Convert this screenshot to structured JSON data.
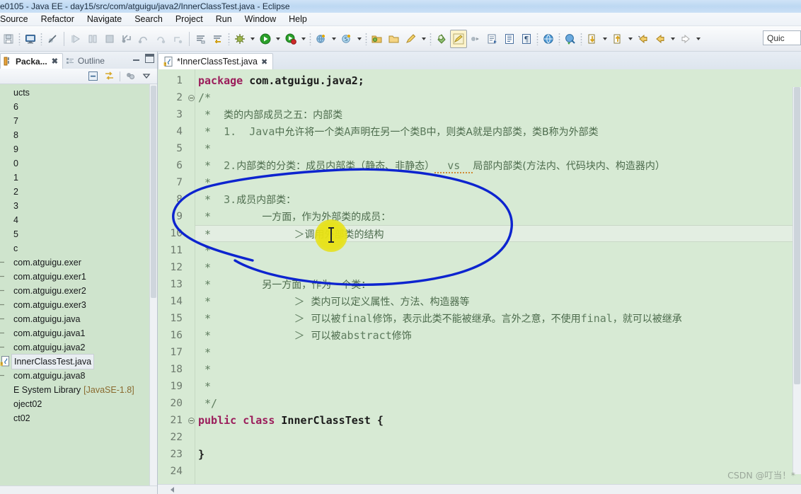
{
  "window": {
    "title": "e0105 - Java EE - day15/src/com/atguigu/java2/InnerClassTest.java - Eclipse"
  },
  "menubar": {
    "items": [
      {
        "label": "Source"
      },
      {
        "label": "Refactor"
      },
      {
        "label": "Navigate"
      },
      {
        "label": "Search"
      },
      {
        "label": "Project"
      },
      {
        "label": "Run"
      },
      {
        "label": "Window"
      },
      {
        "label": "Help"
      }
    ]
  },
  "toolbar": {
    "quick_access_text": "Quic",
    "buttons": [
      {
        "name": "save-icon"
      },
      {
        "name": "console-icon"
      },
      {
        "name": "skip-breakpoints-icon"
      },
      {
        "name": "resume-icon"
      },
      {
        "name": "suspend-icon"
      },
      {
        "name": "terminate-icon"
      },
      {
        "name": "step-into-icon"
      },
      {
        "name": "step-over-icon"
      },
      {
        "name": "step-return-icon"
      },
      {
        "name": "drop-to-frame-icon"
      },
      {
        "name": "open-task-icon"
      },
      {
        "name": "toggle-task-icon"
      },
      {
        "name": "debug-icon"
      },
      {
        "name": "run-icon"
      },
      {
        "name": "run-coverage-icon"
      },
      {
        "name": "external-tools-icon"
      },
      {
        "name": "search-icon"
      },
      {
        "name": "new-java-package-icon"
      },
      {
        "name": "new-java-class-icon"
      },
      {
        "name": "new-annotation-icon"
      },
      {
        "name": "new-java-project-icon"
      },
      {
        "name": "new-folder-icon"
      },
      {
        "name": "toggle-mark-occurrences-icon"
      },
      {
        "name": "next-annotation-icon"
      },
      {
        "name": "open-type-icon"
      },
      {
        "name": "open-task-list-icon"
      },
      {
        "name": "pilcrow-icon"
      },
      {
        "name": "open-web-browser-icon"
      },
      {
        "name": "previous-edit-icon"
      },
      {
        "name": "next-edit-icon"
      },
      {
        "name": "back-icon"
      },
      {
        "name": "forward-icon"
      }
    ]
  },
  "left_panel": {
    "tabs": [
      {
        "label": "Packa...",
        "active": true,
        "closable": true
      },
      {
        "label": "Outline",
        "active": false,
        "closable": false
      }
    ],
    "view_toolbar": [
      {
        "name": "collapse-all-icon"
      },
      {
        "name": "link-with-editor-icon"
      },
      {
        "name": "view-menu-filters-icon"
      },
      {
        "name": "view-menu-icon"
      }
    ],
    "tree": [
      {
        "label": "ucts",
        "type": "truncated"
      },
      {
        "label": "6",
        "type": "truncated"
      },
      {
        "label": "7",
        "type": "truncated"
      },
      {
        "label": "8",
        "type": "truncated"
      },
      {
        "label": "9",
        "type": "truncated"
      },
      {
        "label": "0",
        "type": "truncated"
      },
      {
        "label": "1",
        "type": "truncated"
      },
      {
        "label": "2",
        "type": "truncated"
      },
      {
        "label": "3",
        "type": "truncated"
      },
      {
        "label": "4",
        "type": "truncated"
      },
      {
        "label": "5",
        "type": "truncated"
      },
      {
        "label": "c",
        "type": "truncated"
      },
      {
        "label": "com.atguigu.exer",
        "type": "package"
      },
      {
        "label": "com.atguigu.exer1",
        "type": "package"
      },
      {
        "label": "com.atguigu.exer2",
        "type": "package"
      },
      {
        "label": "com.atguigu.exer3",
        "type": "package"
      },
      {
        "label": "com.atguigu.java",
        "type": "package"
      },
      {
        "label": "com.atguigu.java1",
        "type": "package"
      },
      {
        "label": "com.atguigu.java2",
        "type": "package"
      },
      {
        "label": "InnerClassTest.java",
        "type": "java-file",
        "selected": true
      },
      {
        "label": "com.atguigu.java8",
        "type": "package"
      },
      {
        "label": "E System Library",
        "suffix": "[JavaSE-1.8]",
        "type": "library"
      },
      {
        "label": "oject02",
        "type": "truncated"
      },
      {
        "label": "ct02",
        "type": "truncated"
      }
    ]
  },
  "editor": {
    "tab": {
      "label": "*InnerClassTest.java",
      "icon": "java-file-warning-icon",
      "close": "✖"
    },
    "current_line": 10,
    "lines": [
      {
        "n": 1,
        "fold": false,
        "tokens": [
          {
            "t": "package ",
            "c": "kw"
          },
          {
            "t": "com.atguigu.java2;",
            "c": "plain"
          }
        ]
      },
      {
        "n": 2,
        "fold": true,
        "tokens": [
          {
            "t": "/*",
            "c": "cmt"
          }
        ]
      },
      {
        "n": 3,
        "fold": false,
        "tokens": [
          {
            "t": " *  ",
            "c": "cmt"
          },
          {
            "t": "类的内部成员之五：内部类",
            "c": "cmtzh"
          }
        ]
      },
      {
        "n": 4,
        "fold": false,
        "tokens": [
          {
            "t": " *  ",
            "c": "cmt"
          },
          {
            "t": "1.",
            "c": "cmt"
          },
          {
            "t": "  Java",
            "c": "cmt"
          },
          {
            "t": "中允许将一个类",
            "c": "cmtzh"
          },
          {
            "t": "A",
            "c": "cmt"
          },
          {
            "t": "声明在另一个类",
            "c": "cmtzh"
          },
          {
            "t": "B",
            "c": "cmt"
          },
          {
            "t": "中，则类A就是内部类，类B称为外部类",
            "c": "cmtzh"
          }
        ]
      },
      {
        "n": 5,
        "fold": false,
        "tokens": [
          {
            "t": " *",
            "c": "cmt"
          }
        ]
      },
      {
        "n": 6,
        "fold": false,
        "tokens": [
          {
            "t": " *  ",
            "c": "cmt"
          },
          {
            "t": "2.",
            "c": "cmt"
          },
          {
            "t": "内部类的分类：成员内部类（静态、非静态）",
            "c": "cmtzh"
          },
          {
            "t": "  vs  ",
            "c": "cmt spell"
          },
          {
            "t": "局部内部类(方法内、代码块内、构造器内）",
            "c": "cmtzh"
          }
        ]
      },
      {
        "n": 7,
        "fold": false,
        "tokens": [
          {
            "t": " *",
            "c": "cmt"
          }
        ]
      },
      {
        "n": 8,
        "fold": false,
        "tokens": [
          {
            "t": " *  ",
            "c": "cmt"
          },
          {
            "t": "3.",
            "c": "cmt"
          },
          {
            "t": "成员内部类：",
            "c": "cmtzh"
          }
        ]
      },
      {
        "n": 9,
        "fold": false,
        "tokens": [
          {
            "t": " *        ",
            "c": "cmt"
          },
          {
            "t": "一方面，作为外部类的成员：",
            "c": "cmtzh"
          }
        ]
      },
      {
        "n": 10,
        "fold": false,
        "tokens": [
          {
            "t": " *             ",
            "c": "cmt"
          },
          {
            "t": "＞",
            "c": "cmt"
          },
          {
            "t": "调用外部类的结构",
            "c": "cmtzh"
          }
        ]
      },
      {
        "n": 11,
        "fold": false,
        "tokens": [
          {
            "t": " *",
            "c": "cmt"
          }
        ]
      },
      {
        "n": 12,
        "fold": false,
        "tokens": [
          {
            "t": " *",
            "c": "cmt"
          }
        ]
      },
      {
        "n": 13,
        "fold": false,
        "tokens": [
          {
            "t": " *        ",
            "c": "cmt"
          },
          {
            "t": "另一方面，作为一个类：",
            "c": "cmtzh"
          }
        ]
      },
      {
        "n": 14,
        "fold": false,
        "tokens": [
          {
            "t": " *             ",
            "c": "cmt"
          },
          {
            "t": "＞ ",
            "c": "cmt"
          },
          {
            "t": "类内可以定义属性、方法、构造器等",
            "c": "cmtzh"
          }
        ]
      },
      {
        "n": 15,
        "fold": false,
        "tokens": [
          {
            "t": " *             ",
            "c": "cmt"
          },
          {
            "t": "＞ ",
            "c": "cmt"
          },
          {
            "t": "可以被",
            "c": "cmtzh"
          },
          {
            "t": "final",
            "c": "cmt"
          },
          {
            "t": "修饰，表示此类不能被继承。言外之意，不使用",
            "c": "cmtzh"
          },
          {
            "t": "final",
            "c": "cmt"
          },
          {
            "t": "，就可以被继承",
            "c": "cmtzh"
          }
        ]
      },
      {
        "n": 16,
        "fold": false,
        "tokens": [
          {
            "t": " *             ",
            "c": "cmt"
          },
          {
            "t": "＞ ",
            "c": "cmt"
          },
          {
            "t": "可以被",
            "c": "cmtzh"
          },
          {
            "t": "abstract",
            "c": "cmt"
          },
          {
            "t": "修饰",
            "c": "cmtzh"
          }
        ]
      },
      {
        "n": 17,
        "fold": false,
        "tokens": [
          {
            "t": " *",
            "c": "cmt"
          }
        ]
      },
      {
        "n": 18,
        "fold": false,
        "tokens": [
          {
            "t": " *",
            "c": "cmt"
          }
        ]
      },
      {
        "n": 19,
        "fold": false,
        "tokens": [
          {
            "t": " *",
            "c": "cmt"
          }
        ]
      },
      {
        "n": 20,
        "fold": false,
        "tokens": [
          {
            "t": " */",
            "c": "cmt"
          }
        ]
      },
      {
        "n": 21,
        "fold": true,
        "tokens": [
          {
            "t": "public class ",
            "c": "kw"
          },
          {
            "t": "InnerClassTest {",
            "c": "typ"
          }
        ]
      },
      {
        "n": 22,
        "fold": false,
        "tokens": [
          {
            "t": "",
            "c": "plain"
          }
        ]
      },
      {
        "n": 23,
        "fold": false,
        "tokens": [
          {
            "t": "}",
            "c": "plain"
          }
        ]
      },
      {
        "n": 24,
        "fold": false,
        "tokens": [
          {
            "t": "",
            "c": "plain"
          }
        ]
      }
    ]
  },
  "annotation": {
    "ink_color": "#0d24cf",
    "click_highlight_color": "#e8e214"
  },
  "watermark": "CSDN @叮当！*"
}
